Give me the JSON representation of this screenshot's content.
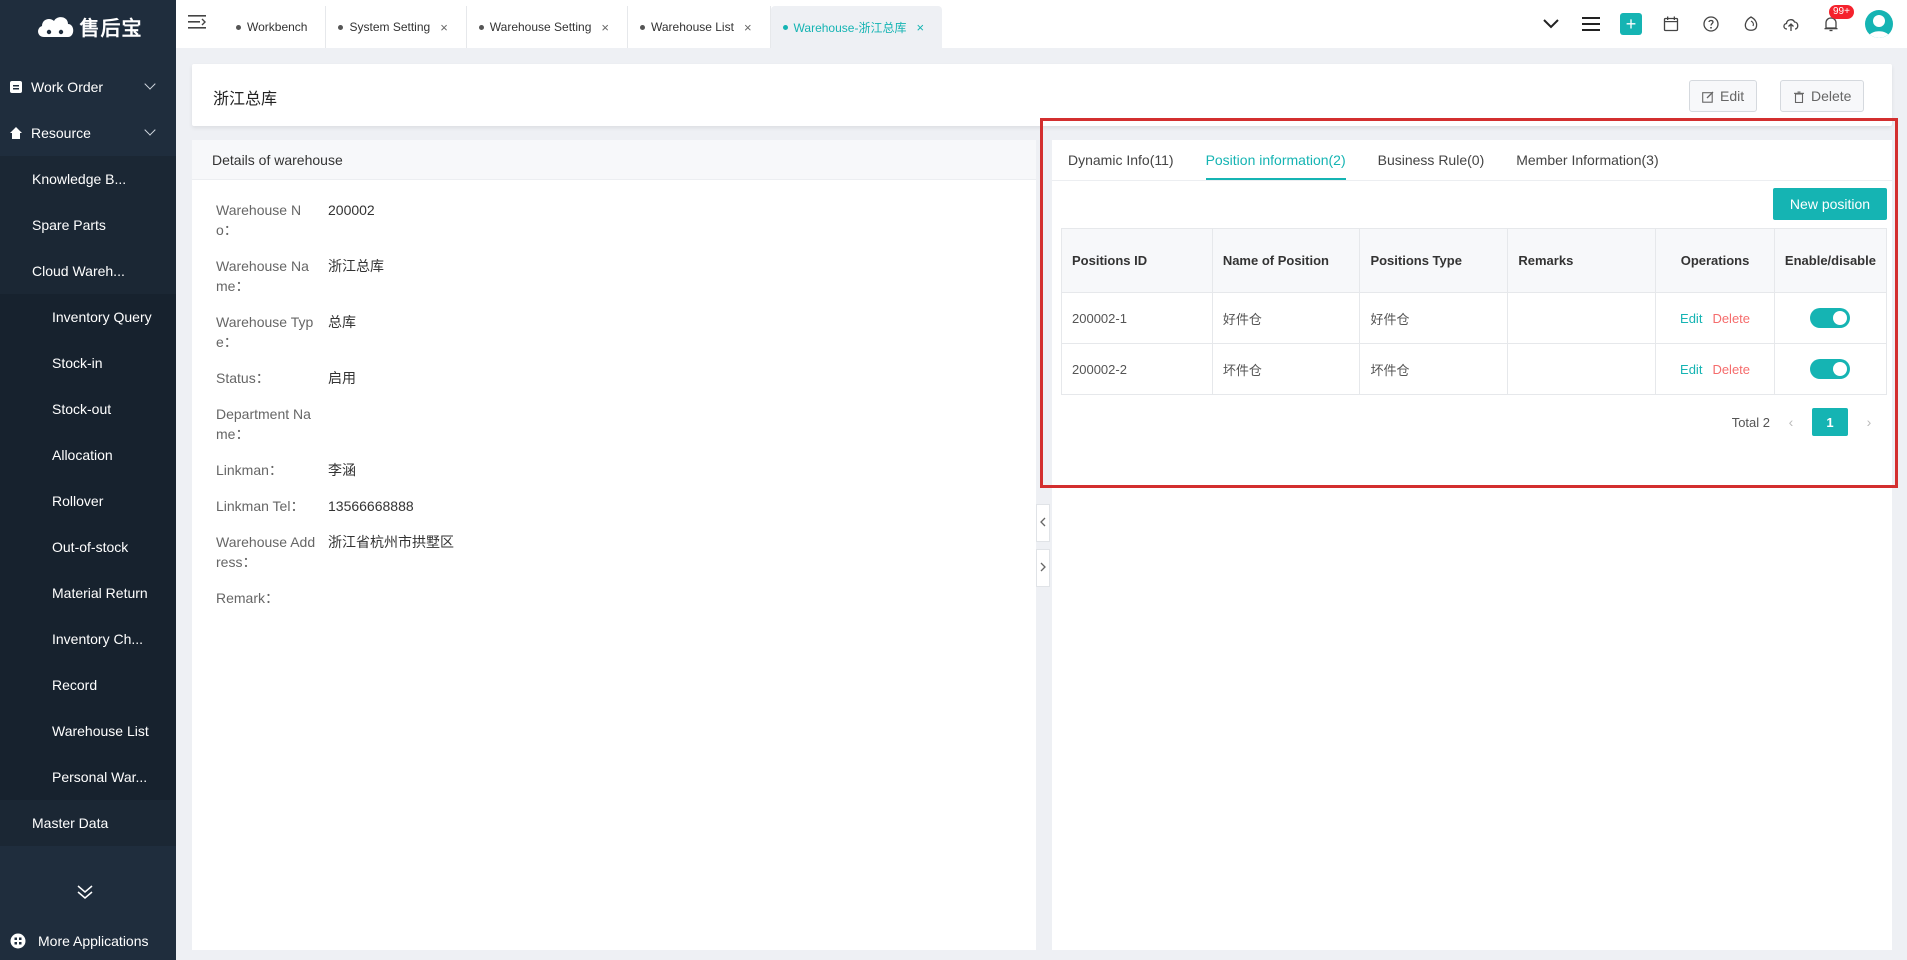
{
  "app": {
    "logo_text": "售后宝"
  },
  "sidebar": {
    "items": [
      {
        "label": "Work Order"
      },
      {
        "label": "Resource"
      },
      {
        "label": "Knowledge B..."
      },
      {
        "label": "Spare Parts"
      },
      {
        "label": "Cloud Wareh..."
      },
      {
        "label": "Inventory Query"
      },
      {
        "label": "Stock-in"
      },
      {
        "label": "Stock-out"
      },
      {
        "label": "Allocation"
      },
      {
        "label": "Rollover"
      },
      {
        "label": "Out-of-stock"
      },
      {
        "label": "Material Return"
      },
      {
        "label": "Inventory Ch..."
      },
      {
        "label": "Record"
      },
      {
        "label": "Warehouse List"
      },
      {
        "label": "Personal War..."
      },
      {
        "label": "Master Data"
      }
    ],
    "more_apps": "More Applications"
  },
  "topbar": {
    "tabs": [
      {
        "label": "Workbench"
      },
      {
        "label": "System Setting"
      },
      {
        "label": "Warehouse Setting"
      },
      {
        "label": "Warehouse List"
      },
      {
        "label": "Warehouse-浙江总库"
      }
    ],
    "notification_count": "99+",
    "accent": "#15b4b3"
  },
  "header": {
    "title": "浙江总库",
    "edit_label": "Edit",
    "delete_label": "Delete"
  },
  "details": {
    "card_title": "Details of warehouse",
    "rows": [
      {
        "label": "Warehouse No：",
        "value": "200002"
      },
      {
        "label": "Warehouse Name：",
        "value": "浙江总库"
      },
      {
        "label": "Warehouse Type：",
        "value": "总库"
      },
      {
        "label": "Status：",
        "value": "启用"
      },
      {
        "label": "Department Name：",
        "value": ""
      },
      {
        "label": "Linkman：",
        "value": "李涵"
      },
      {
        "label": "Linkman Tel：",
        "value": "13566668888"
      },
      {
        "label": "Warehouse Address：",
        "value": "浙江省杭州市拱墅区"
      },
      {
        "label": "Remark：",
        "value": ""
      }
    ]
  },
  "right_panel": {
    "tabs": [
      {
        "label": "Dynamic Info(11)"
      },
      {
        "label": "Position information(2)"
      },
      {
        "label": "Business Rule(0)"
      },
      {
        "label": "Member Information(3)"
      }
    ],
    "new_position_label": "New position",
    "table": {
      "headers": [
        "Positions ID",
        "Name of Position",
        "Positions Type",
        "Remarks",
        "Operations",
        "Enable/disable"
      ],
      "rows": [
        {
          "id": "200002-1",
          "name": "好件仓",
          "type": "好件仓",
          "remarks": "",
          "edit": "Edit",
          "delete": "Delete",
          "enabled": true
        },
        {
          "id": "200002-2",
          "name": "坏件仓",
          "type": "坏件仓",
          "remarks": "",
          "edit": "Edit",
          "delete": "Delete",
          "enabled": true
        }
      ]
    },
    "pagination": {
      "total_label": "Total 2",
      "current_page": "1"
    }
  }
}
